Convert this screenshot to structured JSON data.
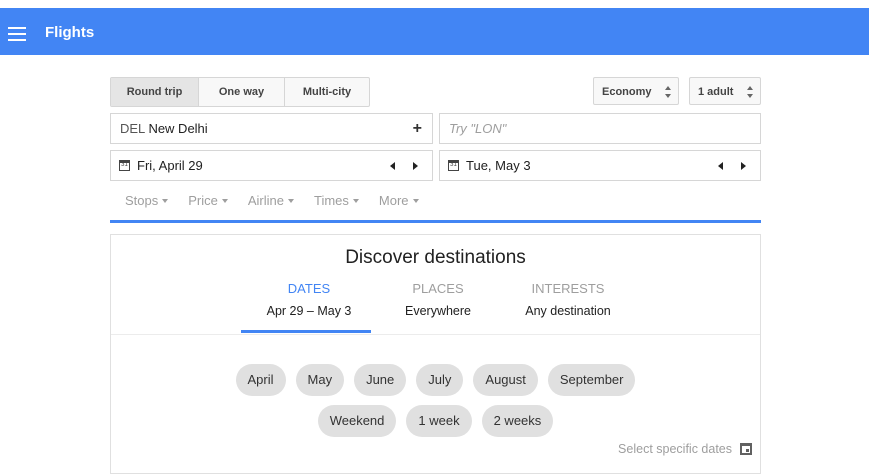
{
  "app": {
    "title": "Flights"
  },
  "trip_type": {
    "options": [
      "Round trip",
      "One way",
      "Multi-city"
    ],
    "selected": "Round trip"
  },
  "cabin": {
    "value": "Economy"
  },
  "passengers": {
    "value": "1 adult"
  },
  "origin": {
    "code": "DEL",
    "city": "New Delhi"
  },
  "destination": {
    "value": "",
    "placeholder": "Try \"LON\""
  },
  "dates": {
    "depart": "Fri, April 29",
    "return": "Tue, May 3",
    "calendar_glyph": "31"
  },
  "filters": [
    "Stops",
    "Price",
    "Airline",
    "Times",
    "More"
  ],
  "discover": {
    "title": "Discover destinations",
    "tabs": [
      {
        "label": "DATES",
        "value": "Apr 29 – May 3",
        "active": true
      },
      {
        "label": "PLACES",
        "value": "Everywhere",
        "active": false
      },
      {
        "label": "INTERESTS",
        "value": "Any destination",
        "active": false
      }
    ],
    "months": [
      "April",
      "May",
      "June",
      "July",
      "August",
      "September"
    ],
    "durations": [
      "Weekend",
      "1 week",
      "2 weeks"
    ],
    "specific_dates": "Select specific dates"
  },
  "colors": {
    "brand_blue": "#4285f4",
    "chip_bg": "#e0e0e0"
  },
  "icons": [
    "menu-icon",
    "plus-icon",
    "calendar-icon",
    "prev-arrow-icon",
    "next-arrow-icon",
    "dropdown-caret-icon"
  ]
}
